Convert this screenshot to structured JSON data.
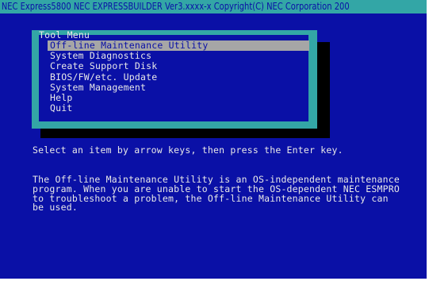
{
  "title_bar": "NEC Express5800 NEC EXPRESSBUILDER Ver3.xxxx-x Copyright(C) NEC Corporation 200",
  "menu": {
    "title": "Tool Menu",
    "items": [
      {
        "label": "Off-line Maintenance Utility",
        "selected": true
      },
      {
        "label": "System Diagnostics",
        "selected": false
      },
      {
        "label": "Create Support Disk",
        "selected": false
      },
      {
        "label": "BIOS/FW/etc. Update",
        "selected": false
      },
      {
        "label": "System Management",
        "selected": false
      },
      {
        "label": "Help",
        "selected": false
      },
      {
        "label": "Quit",
        "selected": false
      }
    ]
  },
  "prompt": "Select an item by arrow keys, then press the Enter key.",
  "description": [
    "The Off-line Maintenance Utility is an OS-independent maintenance",
    "program. When you are unable to start the OS-dependent NEC ESMPRO",
    "to troubleshoot a problem, the Off-line Maintenance Utility can",
    "be used."
  ],
  "colors": {
    "background": "#0a10a6",
    "frame": "#33a6a6",
    "highlight": "#a6a6a6",
    "text": "#e8e8e8",
    "shadow": "#000000"
  }
}
